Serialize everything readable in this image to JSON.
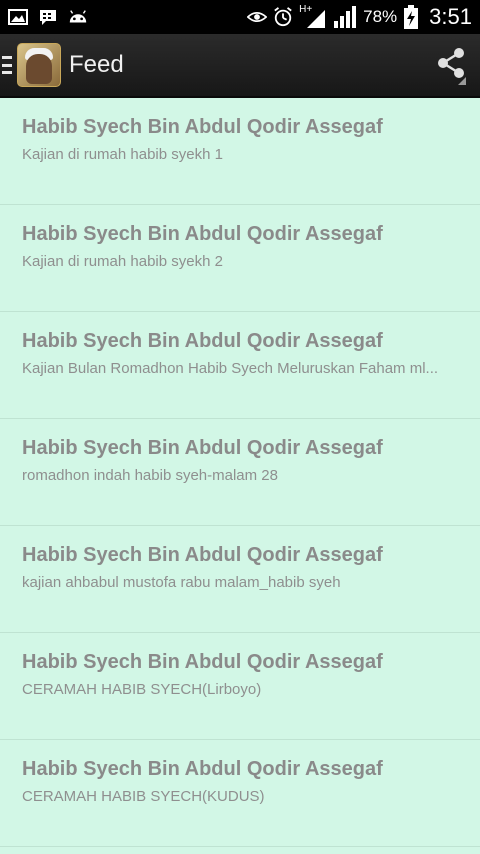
{
  "status_bar": {
    "battery_percent": "78%",
    "time": "3:51",
    "network_label": "H+",
    "icons": [
      "image-icon",
      "bbm-icon",
      "android-icon",
      "eye-icon",
      "alarm-icon",
      "signal-h-plus-icon",
      "signal-icon",
      "battery-charging-icon"
    ]
  },
  "action_bar": {
    "title": "Feed",
    "share_icon": "share-icon"
  },
  "feed": {
    "items": [
      {
        "title": "Habib Syech Bin Abdul Qodir Assegaf",
        "subtitle": "Kajian di rumah habib syekh 1"
      },
      {
        "title": "Habib Syech Bin Abdul Qodir Assegaf",
        "subtitle": "Kajian di rumah habib syekh 2"
      },
      {
        "title": "Habib Syech Bin Abdul Qodir Assegaf",
        "subtitle": "Kajian Bulan Romadhon Habib Syech Meluruskan Faham ml..."
      },
      {
        "title": "Habib Syech Bin Abdul Qodir Assegaf",
        "subtitle": "romadhon indah habib syeh-malam 28"
      },
      {
        "title": "Habib Syech Bin Abdul Qodir Assegaf",
        "subtitle": "kajian ahbabul mustofa rabu malam_habib syeh"
      },
      {
        "title": "Habib Syech Bin Abdul Qodir Assegaf",
        "subtitle": "CERAMAH HABIB SYECH(Lirboyo)"
      },
      {
        "title": "Habib Syech Bin Abdul Qodir Assegaf",
        "subtitle": "CERAMAH HABIB SYECH(KUDUS)"
      }
    ]
  },
  "colors": {
    "list_background": "#d2f7e6",
    "action_bar": "#1f1f1f",
    "status_bar": "#000000",
    "item_title": "#8a8a8a"
  }
}
